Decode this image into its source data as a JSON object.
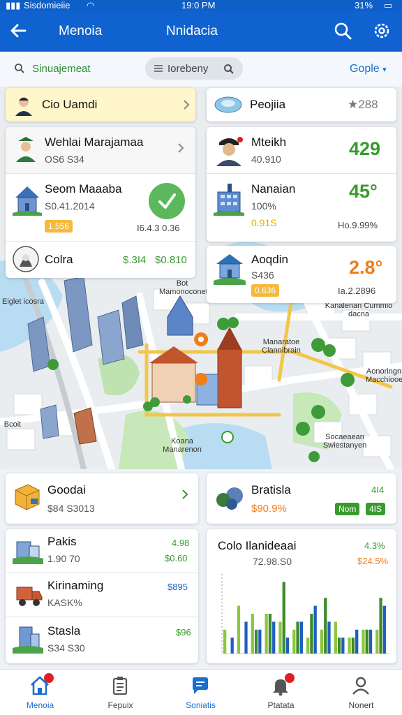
{
  "status_bar": {
    "carrier": "Sisdomieiie",
    "time": "19:0 PM",
    "battery": "31%"
  },
  "header": {
    "left_title": "Menoia",
    "center_title": "Nnidacia"
  },
  "search": {
    "location_label": "Sinuajemeat",
    "pill_text": "Iorebeny",
    "google_label": "Gople"
  },
  "map": {
    "labels": [
      "Bot Mamonoconet",
      "Eiglet icosra",
      "Kanalenan Cummio dacna",
      "Manaratoe Clannibrain",
      "Aonoringn Macchiooee",
      "Koana Manarenon",
      "Socaeaean Swiestanyen",
      "Bcoit"
    ]
  },
  "overlay_cards": {
    "top_left": {
      "name": "Cio Uamdi"
    },
    "top_right": {
      "name": "Peojiia",
      "value": "★288"
    },
    "left_list": [
      {
        "name": "Wehlai Marajamaa",
        "sub": "OS6 S34"
      },
      {
        "name": "Seom Maaaba",
        "sub": "S0.41.2014",
        "badge": "1.556",
        "extra": "I6.4.3 0.36"
      },
      {
        "name": "Colra",
        "value1": "$.3I4",
        "value2": "$0.810"
      }
    ],
    "right_list": [
      {
        "name": "Mteikh",
        "sub": "40.910",
        "value": "429"
      },
      {
        "name": "Nanaian",
        "sub": "100%",
        "badge": "0.91S",
        "value": "45°",
        "extra": "Ho.9.99%"
      },
      {
        "name": "Aoqdin",
        "sub": "S436",
        "badge": "0.636",
        "value": "2.8°",
        "extra": "Ia.2.2896"
      }
    ]
  },
  "bottom_cards": {
    "left": [
      {
        "name": "Goodai",
        "sub": "$84 S3013"
      },
      {
        "name": "Pakis",
        "sub": "1.90 70",
        "value1": "4.98",
        "value2": "$0.60"
      },
      {
        "name": "Kirinaming",
        "sub": "KASK%",
        "value1": "$895"
      },
      {
        "name": "Stasla",
        "sub": "S34 S30",
        "value1": "$96"
      }
    ],
    "right_top": {
      "name": "Bratisla",
      "sub": "$90.9%",
      "value": "4I4",
      "badge1": "Nom",
      "badge2": "4IS"
    },
    "chart_card": {
      "title": "Colo Ilanideaai",
      "sub": "72.98.S0",
      "value1": "4.3%",
      "value2": "$24.5%"
    }
  },
  "chart_data": {
    "type": "bar",
    "title": "Colo Ilanideaai",
    "series": [
      {
        "name": "",
        "color": "#8cc63f",
        "values": [
          3,
          6,
          5,
          5,
          4,
          3,
          2,
          3,
          4,
          2,
          3,
          3
        ]
      },
      {
        "name": "",
        "color": "#3d8b2a",
        "values": [
          0,
          0,
          3,
          5,
          9,
          4,
          5,
          7,
          2,
          2,
          3,
          7
        ]
      },
      {
        "name": "",
        "color": "#1f5fc0",
        "values": [
          2,
          4,
          3,
          4,
          2,
          4,
          6,
          4,
          2,
          3,
          3,
          6
        ]
      }
    ],
    "ylim": [
      0,
      10
    ]
  },
  "bottom_nav": {
    "tabs": [
      {
        "label": "Menoia"
      },
      {
        "label": "Fepuix"
      },
      {
        "label": "Soniatis"
      },
      {
        "label": "Ptatata"
      },
      {
        "label": "Nonert"
      }
    ]
  },
  "colors": {
    "primary": "#0f62cf",
    "accent_green": "#3a9a2e",
    "accent_orange": "#f07d1a",
    "highlight_yellow": "#fff6cc"
  }
}
